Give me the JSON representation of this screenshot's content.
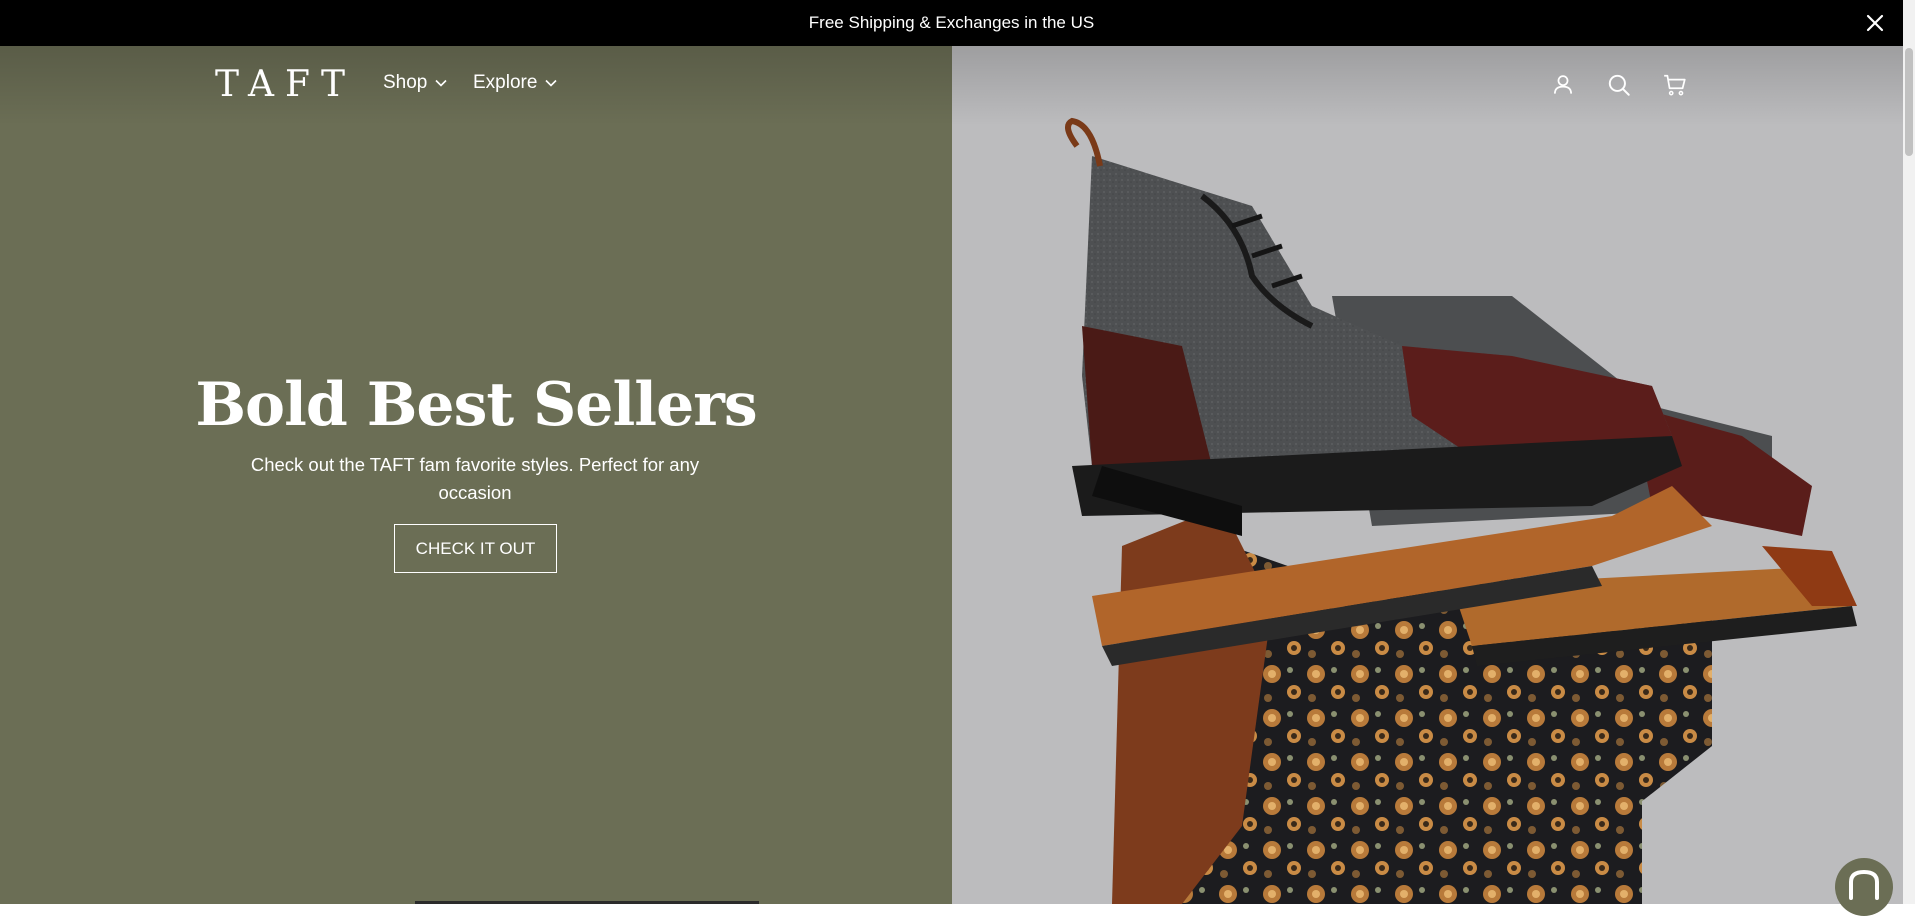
{
  "announcement": {
    "text": "Free Shipping & Exchanges in the US",
    "close_icon": "close-icon"
  },
  "header": {
    "logo_text": "TAFT",
    "nav": [
      {
        "label": "Shop",
        "icon": "chevron-down-icon"
      },
      {
        "label": "Explore",
        "icon": "chevron-down-icon"
      }
    ],
    "icons": [
      "account-icon",
      "search-icon",
      "cart-icon"
    ]
  },
  "hero": {
    "title": "Bold Best Sellers",
    "subtitle": "Check out the TAFT fam favorite styles. Perfect for any occasion",
    "cta_label": "CHECK IT OUT",
    "image_alt": "Stacked boots and shoes: wool cap-toe boot and floral brocade boots",
    "left_bg": "#6b6e55",
    "right_bg": "#bcbcbe"
  },
  "chat": {
    "icon": "chat-icon"
  }
}
